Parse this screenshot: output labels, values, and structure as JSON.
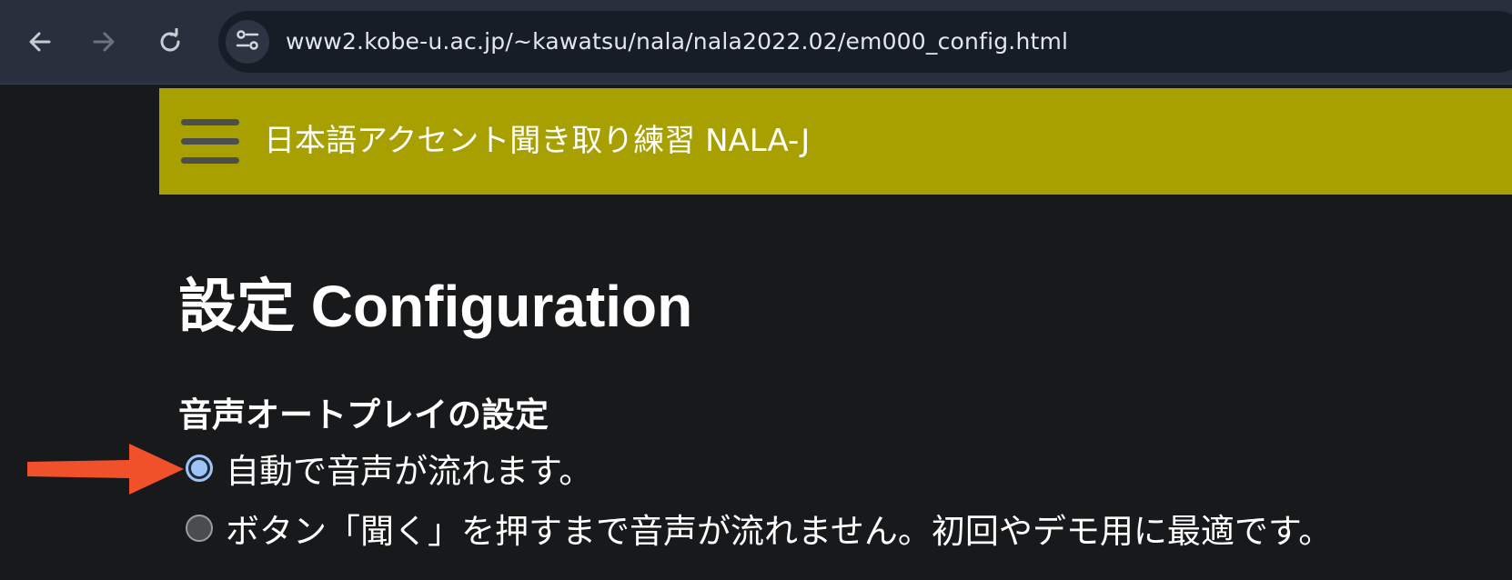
{
  "browser": {
    "url": "www2.kobe-u.ac.jp/~kawatsu/nala/nala2022.02/em000_config.html",
    "back_icon": "arrow-left-icon",
    "forward_icon": "arrow-right-icon",
    "reload_icon": "reload-icon",
    "site_info_icon": "tune-icon"
  },
  "app_header": {
    "title": "日本語アクセント聞き取り練習 NALA-J",
    "background_color": "#a8a000",
    "menu_icon": "hamburger-menu-icon"
  },
  "main": {
    "page_title": "設定 Configuration",
    "autoplay_section": {
      "heading": "音声オートプレイの設定",
      "options": [
        {
          "label": "自動で音声が流れます。",
          "selected": true
        },
        {
          "label": "ボタン「聞く」を押すまで音声が流れません。初回やデモ用に最適です。",
          "selected": false
        }
      ]
    }
  },
  "annotation": {
    "icon": "red-arrow-icon",
    "color": "#f0512a"
  }
}
